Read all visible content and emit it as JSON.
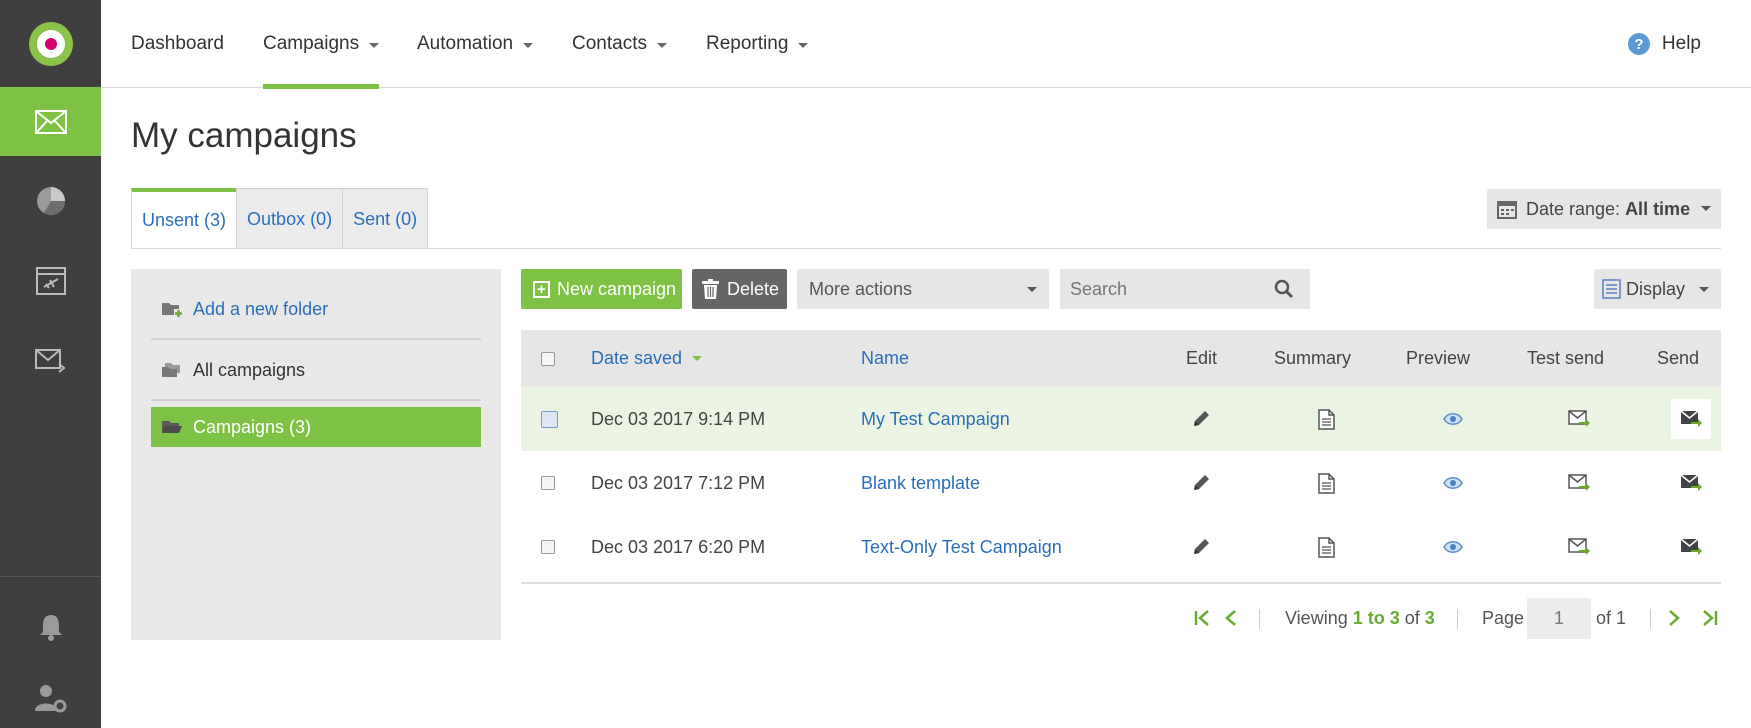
{
  "nav": {
    "items": [
      {
        "label": "Dashboard"
      },
      {
        "label": "Campaigns"
      },
      {
        "label": "Automation"
      },
      {
        "label": "Contacts"
      },
      {
        "label": "Reporting"
      }
    ],
    "help": "Help"
  },
  "page": {
    "title": "My campaigns"
  },
  "tabs": [
    {
      "label": "Unsent (3)"
    },
    {
      "label": "Outbox (0)"
    },
    {
      "label": "Sent (0)"
    }
  ],
  "date_range": {
    "label": "Date range:",
    "value": "All time"
  },
  "folders": {
    "add": "Add a new folder",
    "all": "All campaigns",
    "campaigns": "Campaigns (3)"
  },
  "toolbar": {
    "new": "New campaign",
    "delete": "Delete",
    "more": "More actions",
    "search_placeholder": "Search",
    "display": "Display"
  },
  "table": {
    "headers": {
      "date": "Date saved",
      "name": "Name",
      "edit": "Edit",
      "summary": "Summary",
      "preview": "Preview",
      "test_send": "Test send",
      "send": "Send"
    },
    "rows": [
      {
        "date": "Dec 03 2017 9:14 PM",
        "name": "My Test Campaign"
      },
      {
        "date": "Dec 03 2017 7:12 PM",
        "name": "Blank template"
      },
      {
        "date": "Dec 03 2017 6:20 PM",
        "name": "Text-Only Test Campaign"
      }
    ]
  },
  "pager": {
    "viewing": "Viewing",
    "range": "1 to 3",
    "of": "of",
    "total": "3",
    "page_label": "Page",
    "page_value": "1",
    "of_pages": "of 1"
  },
  "colors": {
    "accent": "#7dc244",
    "link": "#2a6ebb",
    "rail": "#3f3f3f"
  }
}
